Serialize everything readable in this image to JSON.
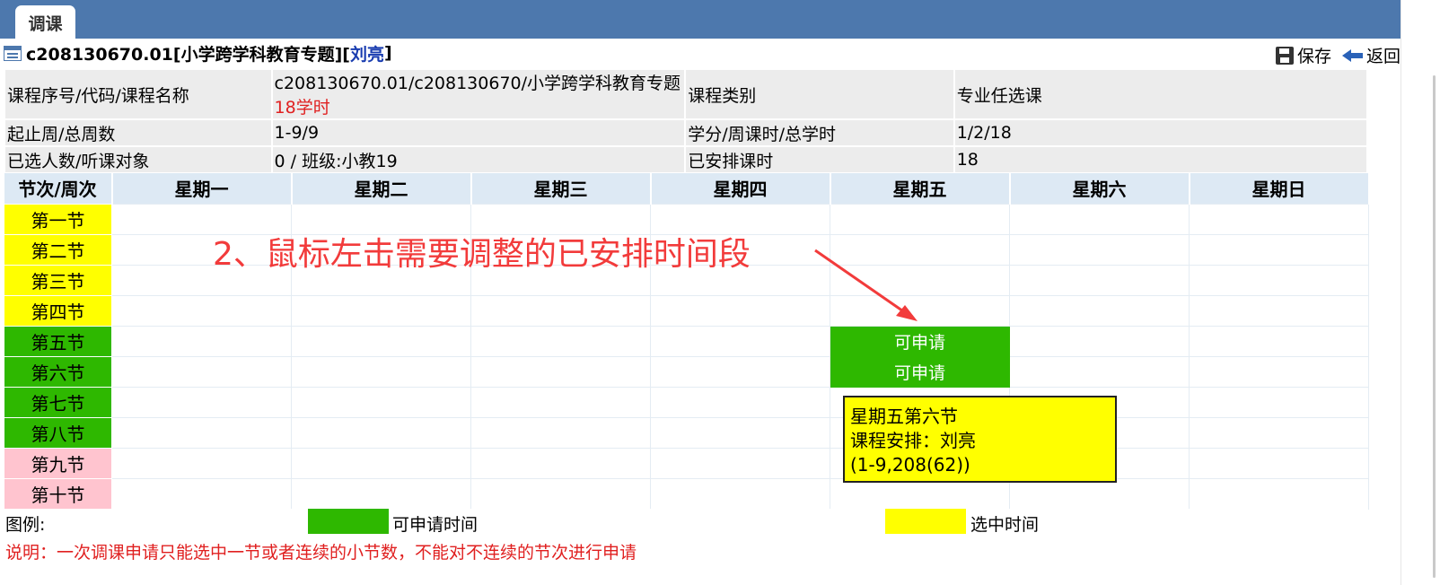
{
  "tab": {
    "label": "调课"
  },
  "title": {
    "code": "c208130670.01[小学跨学科教育专题][",
    "teacher": "刘亮",
    "close": "]"
  },
  "actions": {
    "save": "保存",
    "back": "返回"
  },
  "info": {
    "course_label": "课程序号/代码/课程名称",
    "course_value": "c208130670.01/c208130670/小学跨学科教育专题",
    "course_hours": "18学时",
    "category_label": "课程类别",
    "category_value": "专业任选课",
    "weeks_label": "起止周/总周数",
    "weeks_value": "1-9/9",
    "credit_label": "学分/周课时/总学时",
    "credit_value": "1/2/18",
    "selected_label": "已选人数/听课对象",
    "selected_value": "0 / 班级:小教19",
    "arranged_label": "已安排课时",
    "arranged_value": "18"
  },
  "schedule": {
    "corner": "节次/周次",
    "days": [
      "星期一",
      "星期二",
      "星期三",
      "星期四",
      "星期五",
      "星期六",
      "星期日"
    ],
    "periods": [
      {
        "label": "第一节",
        "status": "yellow"
      },
      {
        "label": "第二节",
        "status": "yellow"
      },
      {
        "label": "第三节",
        "status": "yellow"
      },
      {
        "label": "第四节",
        "status": "yellow"
      },
      {
        "label": "第五节",
        "status": "green"
      },
      {
        "label": "第六节",
        "status": "green"
      },
      {
        "label": "第七节",
        "status": "green"
      },
      {
        "label": "第八节",
        "status": "green"
      },
      {
        "label": "第九节",
        "status": "pink"
      },
      {
        "label": "第十节",
        "status": "pink"
      }
    ],
    "cells": [
      {
        "period": 5,
        "day": 5,
        "text": "可申请"
      },
      {
        "period": 6,
        "day": 5,
        "text": "可申请"
      }
    ]
  },
  "annotation": "2、鼠标左击需要调整的已安排时间段",
  "tooltip": {
    "line1": "星期五第六节",
    "line2": "课程安排：刘亮",
    "line3": "(1-9,208(62))"
  },
  "legend": {
    "label": "图例:",
    "available": "可申请时间",
    "selected": "选中时间",
    "note": "说明：一次调课申请只能选中一节或者连续的小节数，不能对不连续的节次进行申请"
  },
  "colors": {
    "header": "#4d78ad",
    "available": "#2eb800",
    "selected": "#ffff00",
    "afternoon": "#2eb800",
    "evening": "#ffc4cf"
  }
}
